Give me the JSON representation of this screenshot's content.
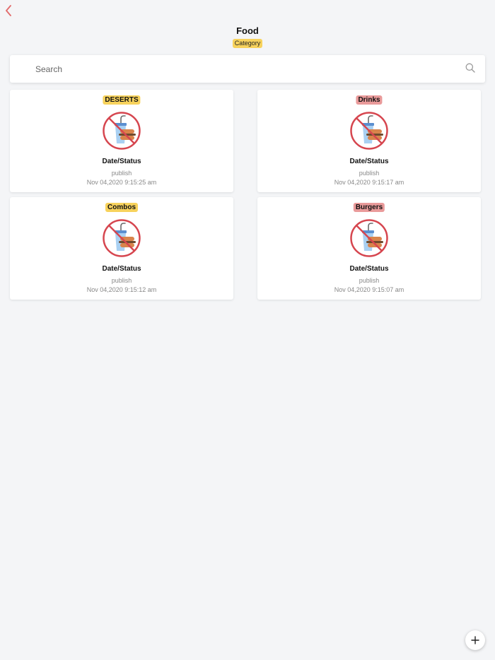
{
  "header": {
    "title": "Food",
    "subtitle": "Category",
    "back_icon": "chevron-left-icon"
  },
  "search": {
    "placeholder": "Search",
    "value": "",
    "icon": "search-icon"
  },
  "cards": [
    {
      "label": "DESERTS",
      "label_color": "#f7d25c",
      "image_icon": "no-food-icon",
      "heading": "Date/Status",
      "status": "publish",
      "date": "Nov 04,2020 9:15:25 am"
    },
    {
      "label": "Drinks",
      "label_color": "#e99a9a",
      "image_icon": "no-food-icon",
      "heading": "Date/Status",
      "status": "publish",
      "date": "Nov 04,2020 9:15:17 am"
    },
    {
      "label": "Combos",
      "label_color": "#f7d25c",
      "image_icon": "no-food-icon",
      "heading": "Date/Status",
      "status": "publish",
      "date": "Nov 04,2020 9:15:12 am"
    },
    {
      "label": "Burgers",
      "label_color": "#e99a9a",
      "image_icon": "no-food-icon",
      "heading": "Date/Status",
      "status": "publish",
      "date": "Nov 04,2020 9:15:07 am"
    }
  ],
  "fab": {
    "icon": "plus-icon"
  },
  "colors": {
    "accent": "#e26a6a",
    "background": "#f4f5f7",
    "badge_yellow": "#f7d25c",
    "badge_red": "#e99a9a"
  }
}
